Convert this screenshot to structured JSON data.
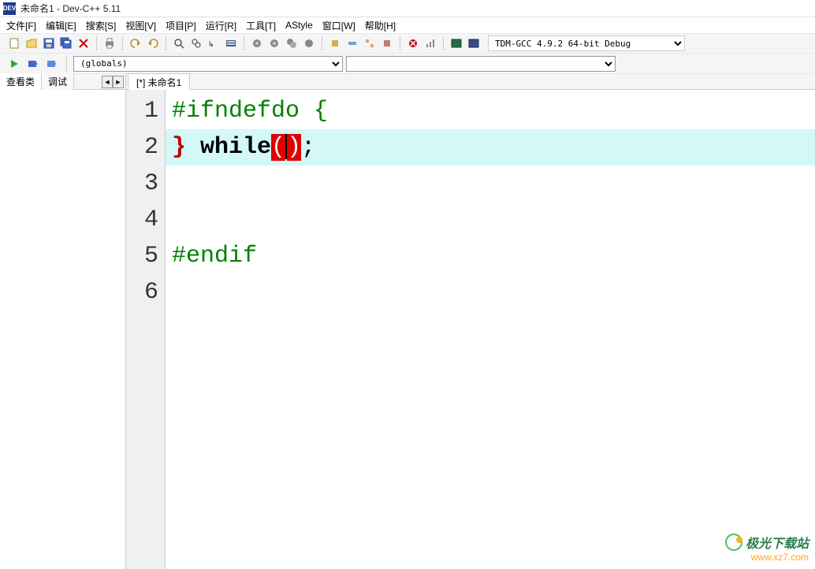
{
  "titlebar": {
    "app_icon_text": "DEV",
    "title": "未命名1 - Dev-C++ 5.11"
  },
  "menubar": {
    "items": [
      "文件[F]",
      "编辑[E]",
      "搜索[S]",
      "视图[V]",
      "项目[P]",
      "运行[R]",
      "工具[T]",
      "AStyle",
      "窗口[W]",
      "帮助[H]"
    ]
  },
  "toolbar": {
    "compiler": "TDM-GCC 4.9.2 64-bit Debug"
  },
  "toolbar2": {
    "scope": "(globals)",
    "member": ""
  },
  "left_panel": {
    "tabs": [
      "查看类",
      "调试"
    ],
    "arrows": [
      "◄",
      "►"
    ]
  },
  "editor": {
    "tab": "[*] 未命名1",
    "lines": [
      {
        "n": "1",
        "type": "preproc",
        "text": "#ifndefdo {"
      },
      {
        "n": "2",
        "type": "while",
        "brace": "}",
        "space": " ",
        "kw": "while",
        "p1": "(",
        "p2": ")",
        "semi": ";"
      },
      {
        "n": "3",
        "type": "blank"
      },
      {
        "n": "4",
        "type": "blank"
      },
      {
        "n": "5",
        "type": "preproc",
        "text": "#endif"
      },
      {
        "n": "6",
        "type": "blank"
      }
    ]
  },
  "watermark": {
    "text": "极光下载站",
    "url": "www.xz7.com"
  }
}
